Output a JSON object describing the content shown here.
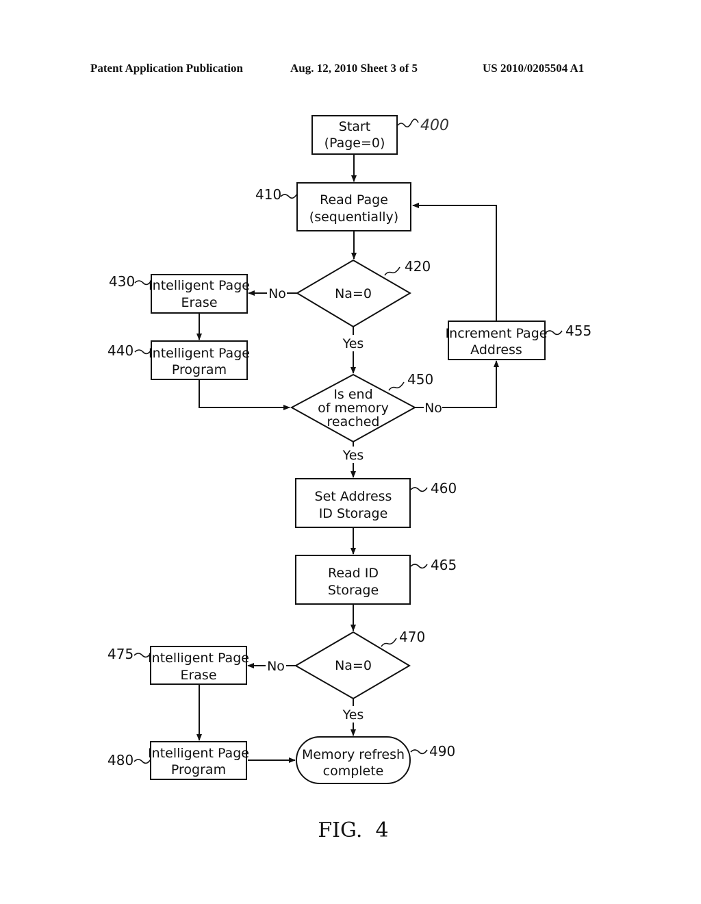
{
  "header": {
    "left": "Patent Application Publication",
    "center": "Aug. 12, 2010  Sheet 3 of 5",
    "right": "US 2010/0205504 A1"
  },
  "nodes": {
    "n400": {
      "ref": "400",
      "lines": [
        "Start",
        "(Page=0)"
      ],
      "type": "process"
    },
    "n410": {
      "ref": "410",
      "lines": [
        "Read Page",
        "(sequentially)"
      ],
      "type": "process"
    },
    "n420": {
      "ref": "420",
      "lines": [
        "Na=0"
      ],
      "type": "decision"
    },
    "n430": {
      "ref": "430",
      "lines": [
        "Intelligent Page",
        "Erase"
      ],
      "type": "process"
    },
    "n440": {
      "ref": "440",
      "lines": [
        "Intelligent Page",
        "Program"
      ],
      "type": "process"
    },
    "n450": {
      "ref": "450",
      "lines": [
        "Is end",
        "of memory",
        "reached"
      ],
      "type": "decision"
    },
    "n455": {
      "ref": "455",
      "lines": [
        "Increment Page",
        "Address"
      ],
      "type": "process"
    },
    "n460": {
      "ref": "460",
      "lines": [
        "Set Address",
        "ID Storage"
      ],
      "type": "process"
    },
    "n465": {
      "ref": "465",
      "lines": [
        "Read ID",
        "Storage"
      ],
      "type": "process"
    },
    "n470": {
      "ref": "470",
      "lines": [
        "Na=0"
      ],
      "type": "decision"
    },
    "n475": {
      "ref": "475",
      "lines": [
        "Intelligent Page",
        "Erase"
      ],
      "type": "process"
    },
    "n480": {
      "ref": "480",
      "lines": [
        "Intelligent Page",
        "Program"
      ],
      "type": "process"
    },
    "n490": {
      "ref": "490",
      "lines": [
        "Memory refresh",
        "complete"
      ],
      "type": "terminal"
    }
  },
  "edge_labels": {
    "e420_no": "No",
    "e420_yes": "Yes",
    "e450_no": "No",
    "e450_yes": "Yes",
    "e470_no": "No",
    "e470_yes": "Yes"
  },
  "edges": [
    {
      "from": "400",
      "to": "410"
    },
    {
      "from": "410",
      "to": "420"
    },
    {
      "from": "420",
      "to": "430",
      "label": "No"
    },
    {
      "from": "420",
      "to": "450",
      "label": "Yes"
    },
    {
      "from": "430",
      "to": "440"
    },
    {
      "from": "440",
      "to": "450"
    },
    {
      "from": "450",
      "to": "455",
      "label": "No"
    },
    {
      "from": "455",
      "to": "410"
    },
    {
      "from": "450",
      "to": "460",
      "label": "Yes"
    },
    {
      "from": "460",
      "to": "465"
    },
    {
      "from": "465",
      "to": "470"
    },
    {
      "from": "470",
      "to": "475",
      "label": "No"
    },
    {
      "from": "470",
      "to": "490",
      "label": "Yes"
    },
    {
      "from": "475",
      "to": "480"
    },
    {
      "from": "480",
      "to": "490"
    }
  ],
  "figure_caption": "FIG.  4"
}
